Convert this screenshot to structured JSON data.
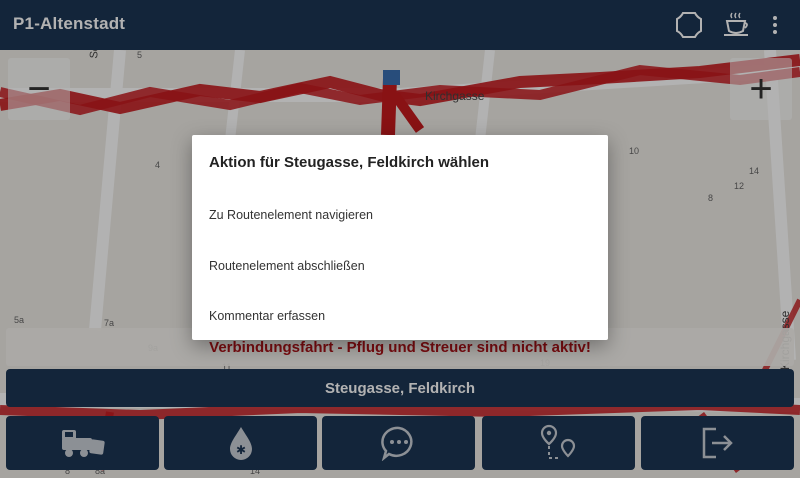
{
  "app": {
    "title": "P1-Altenstadt"
  },
  "header": {
    "icons": [
      "fullscreen-frame-icon",
      "coffee-break-icon",
      "more-vert-icon"
    ]
  },
  "map": {
    "zoom_out_label": "−",
    "zoom_in_label": "+",
    "street_labels": [
      "Sch",
      "Kirchgasse",
      "Kirchgasse"
    ],
    "house_numbers": [
      "5",
      "4",
      "10",
      "14",
      "12",
      "8",
      "5a",
      "7a",
      "9a",
      "11",
      "19",
      "8",
      "8a",
      "10",
      "14"
    ]
  },
  "status": {
    "text": "Verbindungsfahrt - Pflug und Streuer sind nicht aktiv!",
    "color": "#b01218"
  },
  "street_bar": {
    "label": "Steugasse, Feldkirch"
  },
  "dialog": {
    "title": "Aktion für Steugasse, Feldkirch wählen",
    "options": [
      "Zu Routenelement navigieren",
      "Routenelement abschließen",
      "Kommentar erfassen"
    ]
  },
  "bottom_nav": {
    "icons": [
      "snowplow-truck-icon",
      "salt-drop-icon",
      "chat-bubble-icon",
      "route-points-icon",
      "logout-icon"
    ]
  },
  "colors": {
    "primary": "#1c3553",
    "route": "#c41a1e",
    "status": "#b01218"
  }
}
